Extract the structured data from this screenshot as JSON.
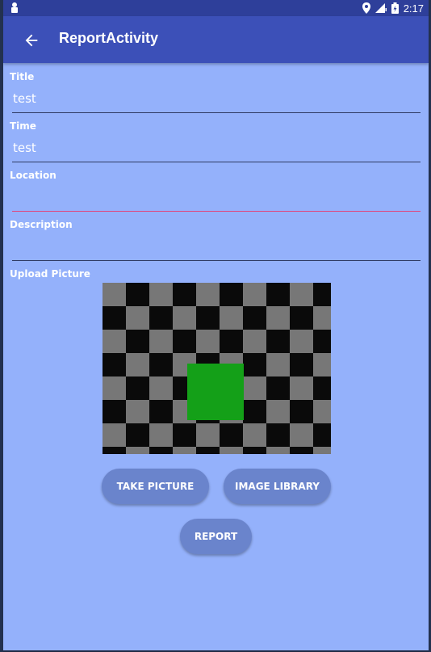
{
  "status_bar": {
    "time": "2:17",
    "icons": [
      "notification-icon",
      "location-icon",
      "signal-icon",
      "battery-icon"
    ]
  },
  "app_bar": {
    "title": "ReportActivity",
    "back_icon": "arrow-back-icon"
  },
  "form": {
    "title": {
      "label": "Title",
      "value": "test"
    },
    "time": {
      "label": "Time",
      "value": "test"
    },
    "location": {
      "label": "Location",
      "value": ""
    },
    "description": {
      "label": "Description",
      "value": ""
    },
    "upload_label": "Upload Picture"
  },
  "buttons": {
    "take_picture": "TAKE PICTURE",
    "image_library": "IMAGE LIBRARY",
    "report": "REPORT"
  },
  "colors": {
    "background": "#94b1fb",
    "app_bar": "#3c50b8",
    "status_bar": "#2e3f9a",
    "button": "#6a84cc",
    "focus_line": "#e0457b"
  }
}
